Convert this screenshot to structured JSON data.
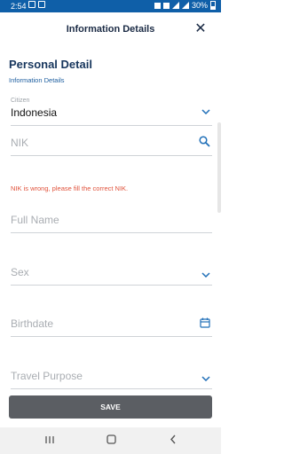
{
  "status_bar": {
    "time": "2:54",
    "battery": "30%"
  },
  "header": {
    "title": "Information Details",
    "close_icon": "close-icon"
  },
  "section": {
    "title": "Personal Detail",
    "subtitle": "Information Details"
  },
  "fields": {
    "citizen": {
      "label": "Citizen",
      "value": "Indonesia",
      "icon": "chevron-down-icon"
    },
    "nik": {
      "placeholder": "NIK",
      "icon": "search-icon",
      "error": "NIK is wrong, please fill the correct NIK."
    },
    "full_name": {
      "placeholder": "Full Name"
    },
    "sex": {
      "placeholder": "Sex",
      "icon": "chevron-down-icon"
    },
    "birthdate": {
      "placeholder": "Birthdate",
      "icon": "calendar-icon"
    },
    "travel_purpose": {
      "placeholder": "Travel Purpose",
      "icon": "chevron-down-icon"
    }
  },
  "actions": {
    "save_label": "SAVE"
  },
  "navbar": {
    "recents_icon": "recents-icon",
    "home_icon": "home-icon",
    "back_icon": "back-icon"
  },
  "colors": {
    "status_bar": "#0f5fa8",
    "accent": "#1f6fb8",
    "error": "#e0523b",
    "button": "#5b5e63"
  }
}
